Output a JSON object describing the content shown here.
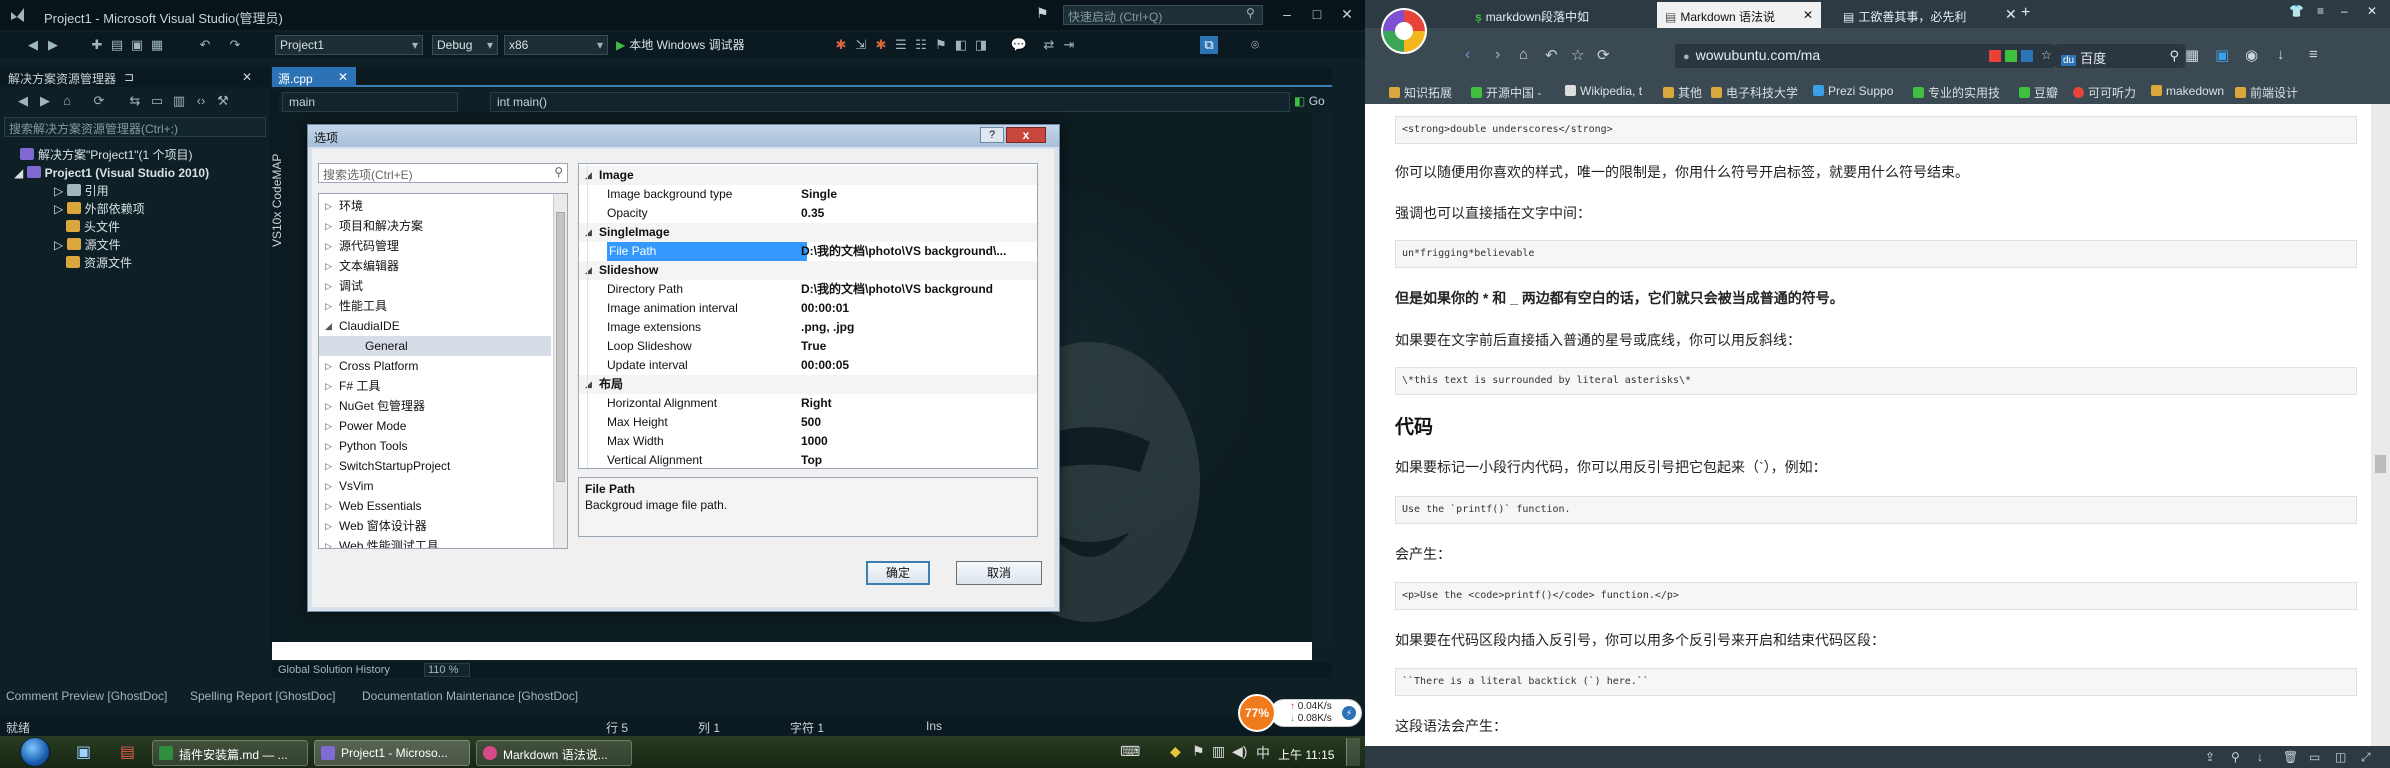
{
  "vs": {
    "title": "Project1 - Microsoft Visual Studio(管理员)",
    "quick_launch_placeholder": "快速启动 (Ctrl+Q)",
    "toolbar": {
      "config": "Debug",
      "platform": "x86",
      "project": "Project1",
      "run": "本地 Windows 调试器"
    },
    "solution_explorer": {
      "header": "解决方案资源管理器",
      "search_placeholder": "搜索解决方案资源管理器(Ctrl+;)",
      "nodes": [
        "解决方案\"Project1\"(1 个项目)",
        "Project1 (Visual Studio 2010)",
        "引用",
        "外部依赖项",
        "头文件",
        "源文件",
        "资源文件"
      ]
    },
    "codemap_label": "VS10x CodeMAP",
    "editor": {
      "tab": "源.cpp",
      "nav_left": "main",
      "nav_right": "int main()",
      "go": "Go",
      "footer_label": "Global Solution History",
      "zoom": "110 %"
    },
    "bottom_tabs": [
      "Comment Preview [GhostDoc]",
      "Spelling Report [GhostDoc]",
      "Documentation Maintenance [GhostDoc]"
    ],
    "status": {
      "ready": "就绪",
      "line": "行 5",
      "col": "列 1",
      "char": "字符 1",
      "ins": "Ins"
    }
  },
  "dialog": {
    "title": "选项",
    "help": "?",
    "close": "x",
    "search_placeholder": "搜索选项(Ctrl+E)",
    "tree": [
      {
        "label": "环境",
        "expander": "▷",
        "selected": false,
        "indent": 0
      },
      {
        "label": "项目和解决方案",
        "expander": "▷",
        "selected": false,
        "indent": 0
      },
      {
        "label": "源代码管理",
        "expander": "▷",
        "selected": false,
        "indent": 0
      },
      {
        "label": "文本编辑器",
        "expander": "▷",
        "selected": false,
        "indent": 0
      },
      {
        "label": "调试",
        "expander": "▷",
        "selected": false,
        "indent": 0
      },
      {
        "label": "性能工具",
        "expander": "▷",
        "selected": false,
        "indent": 0
      },
      {
        "label": "ClaudiaIDE",
        "expander": "◢",
        "selected": false,
        "indent": 0
      },
      {
        "label": "General",
        "expander": "",
        "selected": true,
        "indent": 1
      },
      {
        "label": "Cross Platform",
        "expander": "▷",
        "selected": false,
        "indent": 0
      },
      {
        "label": "F# 工具",
        "expander": "▷",
        "selected": false,
        "indent": 0
      },
      {
        "label": "NuGet 包管理器",
        "expander": "▷",
        "selected": false,
        "indent": 0
      },
      {
        "label": "Power Mode",
        "expander": "▷",
        "selected": false,
        "indent": 0
      },
      {
        "label": "Python Tools",
        "expander": "▷",
        "selected": false,
        "indent": 0
      },
      {
        "label": "SwitchStartupProject",
        "expander": "▷",
        "selected": false,
        "indent": 0
      },
      {
        "label": "VsVim",
        "expander": "▷",
        "selected": false,
        "indent": 0
      },
      {
        "label": "Web Essentials",
        "expander": "▷",
        "selected": false,
        "indent": 0
      },
      {
        "label": "Web 窗体设计器",
        "expander": "▷",
        "selected": false,
        "indent": 0
      },
      {
        "label": "Web 性能测试工具",
        "expander": "▷",
        "selected": false,
        "indent": 0
      }
    ],
    "grid": [
      {
        "type": "cat",
        "name": "Image",
        "value": ""
      },
      {
        "type": "prop",
        "name": "Image background type",
        "value": "Single"
      },
      {
        "type": "prop",
        "name": "Opacity",
        "value": "0.35"
      },
      {
        "type": "cat",
        "name": "SingleImage",
        "value": ""
      },
      {
        "type": "sel",
        "name": "File Path",
        "value": "D:\\我的文档\\photo\\VS background\\..."
      },
      {
        "type": "cat",
        "name": "Slideshow",
        "value": ""
      },
      {
        "type": "prop",
        "name": "Directory Path",
        "value": "D:\\我的文档\\photo\\VS background"
      },
      {
        "type": "prop",
        "name": "Image animation interval",
        "value": "00:00:01"
      },
      {
        "type": "prop",
        "name": "Image extensions",
        "value": ".png, .jpg"
      },
      {
        "type": "prop",
        "name": "Loop Slideshow",
        "value": "True"
      },
      {
        "type": "prop",
        "name": "Update interval",
        "value": "00:00:05"
      },
      {
        "type": "cat",
        "name": "布局",
        "value": ""
      },
      {
        "type": "prop",
        "name": "Horizontal Alignment",
        "value": "Right"
      },
      {
        "type": "prop",
        "name": "Max Height",
        "value": "500"
      },
      {
        "type": "prop",
        "name": "Max Width",
        "value": "1000"
      },
      {
        "type": "prop",
        "name": "Vertical Alignment",
        "value": "Top"
      }
    ],
    "desc_title": "File Path",
    "desc_text": "Backgroud image file path.",
    "ok": "确定",
    "cancel": "取消"
  },
  "browser": {
    "tabs": [
      {
        "label": "markdown段落中如",
        "active": false
      },
      {
        "label": "Markdown 语法说",
        "active": true
      },
      {
        "label": "工欲善其事，必先利",
        "active": false
      }
    ],
    "url": "wowubuntu.com/ma",
    "search_engine": "百度",
    "bookmarks": [
      "知识拓展",
      "开源中国 -",
      "Wikipedia, t",
      "其他",
      "电子科技大学",
      "Prezi Suppo",
      "专业的实用技",
      "豆瓣",
      "可可听力",
      "makedown",
      "前端设计"
    ],
    "content": {
      "code1": "<strong>double underscores</strong>",
      "p1": "你可以随便用你喜欢的样式，唯一的限制是，你用什么符号开启标签，就要用什么符号结束。",
      "p2": "强调也可以直接插在文字中间：",
      "code2": "un*frigging*believable",
      "p3_bold": "但是如果你的 * 和 _ 两边都有空白的话，它们就只会被当成普通的符号。",
      "p4": "如果要在文字前后直接插入普通的星号或底线，你可以用反斜线：",
      "code3": "\\*this text is surrounded by literal asterisks\\*",
      "h_code": "代码",
      "p5": "如果要标记一小段行内代码，你可以用反引号把它包起来（`），例如：",
      "code4": "Use the `printf()` function.",
      "p6": "会产生：",
      "code5": "<p>Use the <code>printf()</code> function.</p>",
      "p7": "如果要在代码区段内插入反引号，你可以用多个反引号来开启和结束代码区段：",
      "code6": "``There is a literal backtick (`) here.``",
      "p8": "这段语法会产生："
    }
  },
  "taskbar": {
    "tasks": [
      "插件安装篇.md — ...",
      "Project1 - Microso...",
      "Markdown 语法说..."
    ],
    "clock": "上午 11:15",
    "net_percent": "77%",
    "net_up": "0.04K/s",
    "net_down": "0.08K/s"
  }
}
